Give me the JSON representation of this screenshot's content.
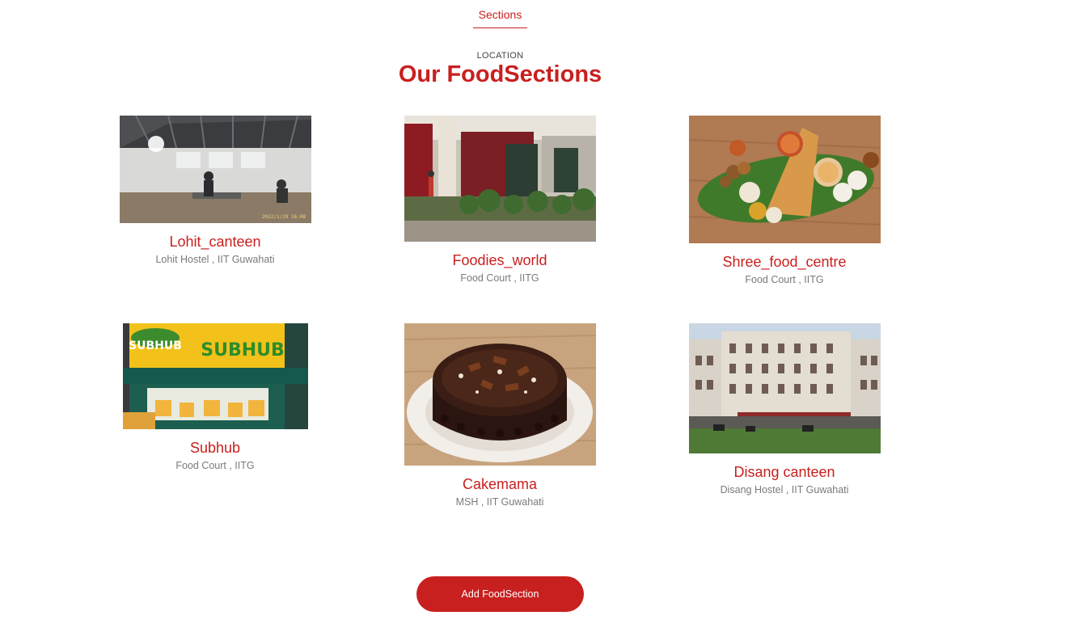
{
  "nav": {
    "tab_label": "Sections"
  },
  "header": {
    "eyebrow": "LOCATION",
    "title": "Our FoodSections"
  },
  "sections": [
    {
      "name": "Lohit_canteen",
      "location": "Lohit Hostel , IIT Guwahati",
      "image": "canteen-interior-photo"
    },
    {
      "name": "Foodies_world",
      "location": "Food Court , IITG",
      "image": "food-court-photo"
    },
    {
      "name": "Shree_food_centre",
      "location": "Food Court , IITG",
      "image": "south-indian-thali-photo"
    },
    {
      "name": "Subhub",
      "location": "Food Court , IITG",
      "image": "subhub-storefront-photo"
    },
    {
      "name": "Cakemama",
      "location": "MSH , IIT Guwahati",
      "image": "chocolate-cake-photo"
    },
    {
      "name": "Disang canteen",
      "location": "Disang Hostel , IIT Guwahati",
      "image": "hostel-building-photo"
    }
  ],
  "actions": {
    "add_label": "Add FoodSection"
  },
  "colors": {
    "accent": "#c8201f",
    "muted_text": "#7a7a7a"
  }
}
